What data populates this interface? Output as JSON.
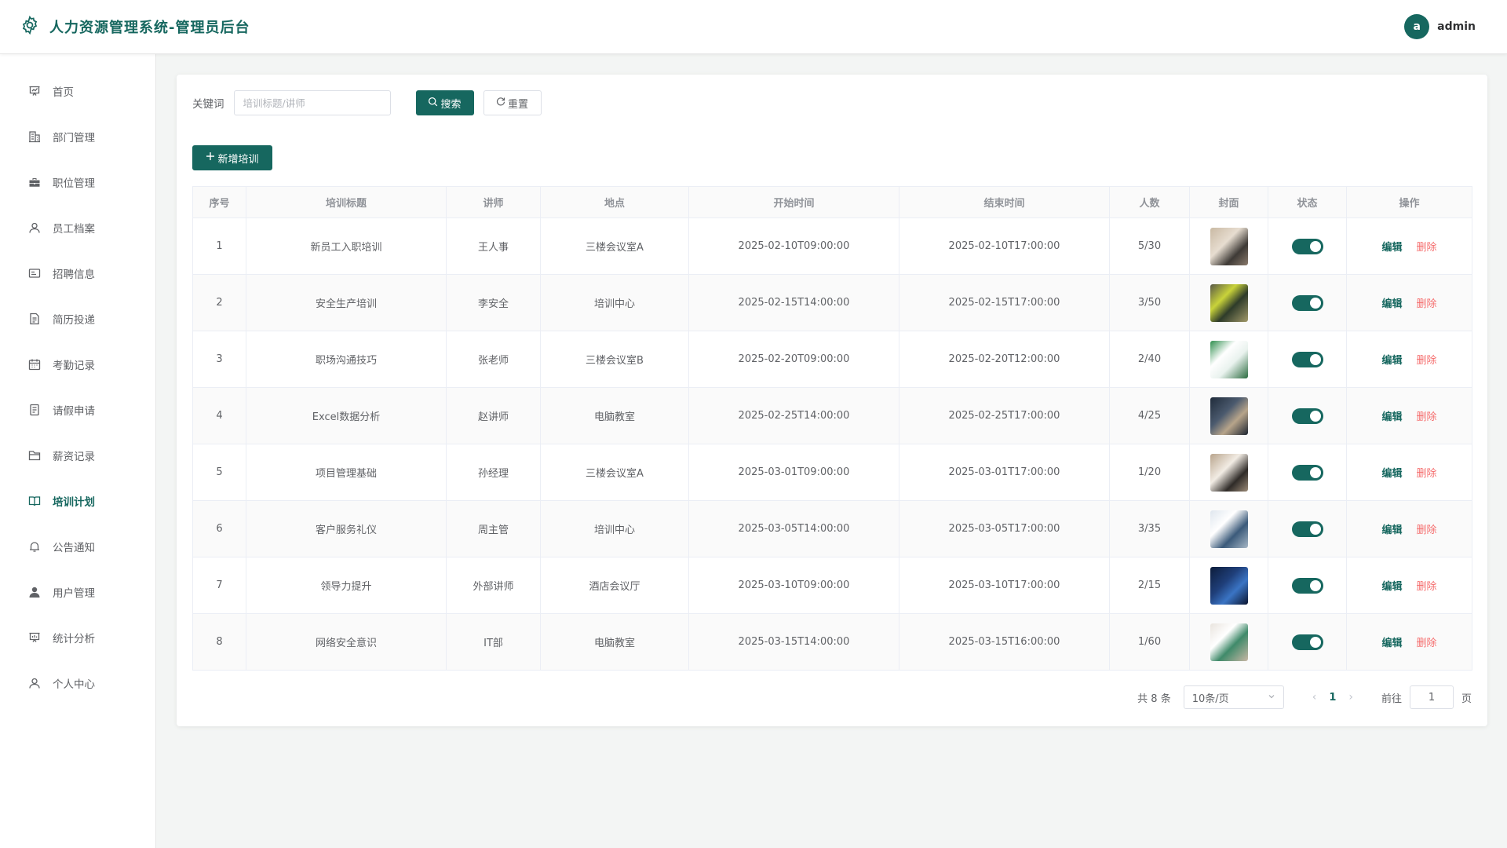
{
  "header": {
    "title": "人力资源管理系统-管理员后台",
    "logo_icon": "gear-icon",
    "user": {
      "avatar_letter": "a",
      "name": "admin"
    }
  },
  "sidebar": {
    "items": [
      {
        "label": "首页",
        "icon": "presentation-icon",
        "active": false
      },
      {
        "label": "部门管理",
        "icon": "building-icon",
        "active": false
      },
      {
        "label": "职位管理",
        "icon": "briefcase-icon",
        "active": false
      },
      {
        "label": "员工档案",
        "icon": "user-outline-icon",
        "active": false
      },
      {
        "label": "招聘信息",
        "icon": "id-card-icon",
        "active": false
      },
      {
        "label": "简历投递",
        "icon": "document-icon",
        "active": false
      },
      {
        "label": "考勤记录",
        "icon": "calendar-icon",
        "active": false
      },
      {
        "label": "请假申请",
        "icon": "tickets-icon",
        "active": false
      },
      {
        "label": "薪资记录",
        "icon": "folder-icon",
        "active": false
      },
      {
        "label": "培训计划",
        "icon": "book-icon",
        "active": true
      },
      {
        "label": "公告通知",
        "icon": "bell-icon",
        "active": false
      },
      {
        "label": "用户管理",
        "icon": "user-filled-icon",
        "active": false
      },
      {
        "label": "统计分析",
        "icon": "data-board-icon",
        "active": false
      },
      {
        "label": "个人中心",
        "icon": "user-outline-icon",
        "active": false
      }
    ]
  },
  "filter": {
    "keyword_label": "关键词",
    "keyword_placeholder": "培训标题/讲师",
    "keyword_value": "",
    "search_label": "搜索",
    "reset_label": "重置"
  },
  "toolbar": {
    "add_label": "新增培训"
  },
  "table": {
    "columns": [
      "序号",
      "培训标题",
      "讲师",
      "地点",
      "开始时间",
      "结束时间",
      "人数",
      "封面",
      "状态",
      "操作"
    ],
    "edit_label": "编辑",
    "delete_label": "删除",
    "rows": [
      {
        "no": "1",
        "title": "新员工入职培训",
        "teacher": "王人事",
        "location": "三楼会议室A",
        "start": "2025-02-10T09:00:00",
        "end": "2025-02-10T17:00:00",
        "count": "5/30",
        "status_on": true
      },
      {
        "no": "2",
        "title": "安全生产培训",
        "teacher": "李安全",
        "location": "培训中心",
        "start": "2025-02-15T14:00:00",
        "end": "2025-02-15T17:00:00",
        "count": "3/50",
        "status_on": true
      },
      {
        "no": "3",
        "title": "职场沟通技巧",
        "teacher": "张老师",
        "location": "三楼会议室B",
        "start": "2025-02-20T09:00:00",
        "end": "2025-02-20T12:00:00",
        "count": "2/40",
        "status_on": true
      },
      {
        "no": "4",
        "title": "Excel数据分析",
        "teacher": "赵讲师",
        "location": "电脑教室",
        "start": "2025-02-25T14:00:00",
        "end": "2025-02-25T17:00:00",
        "count": "4/25",
        "status_on": true
      },
      {
        "no": "5",
        "title": "项目管理基础",
        "teacher": "孙经理",
        "location": "三楼会议室A",
        "start": "2025-03-01T09:00:00",
        "end": "2025-03-01T17:00:00",
        "count": "1/20",
        "status_on": true
      },
      {
        "no": "6",
        "title": "客户服务礼仪",
        "teacher": "周主管",
        "location": "培训中心",
        "start": "2025-03-05T14:00:00",
        "end": "2025-03-05T17:00:00",
        "count": "3/35",
        "status_on": true
      },
      {
        "no": "7",
        "title": "领导力提升",
        "teacher": "外部讲师",
        "location": "酒店会议厅",
        "start": "2025-03-10T09:00:00",
        "end": "2025-03-10T17:00:00",
        "count": "2/15",
        "status_on": true
      },
      {
        "no": "8",
        "title": "网络安全意识",
        "teacher": "IT部",
        "location": "电脑教室",
        "start": "2025-03-15T14:00:00",
        "end": "2025-03-15T16:00:00",
        "count": "1/60",
        "status_on": true
      }
    ]
  },
  "pagination": {
    "total_text": "共 8 条",
    "page_size": "10条/页",
    "current_page": "1",
    "goto_label": "前往",
    "goto_value": "1",
    "page_unit": "页"
  },
  "colors": {
    "primary": "#16675f",
    "danger": "#f56c6c"
  }
}
